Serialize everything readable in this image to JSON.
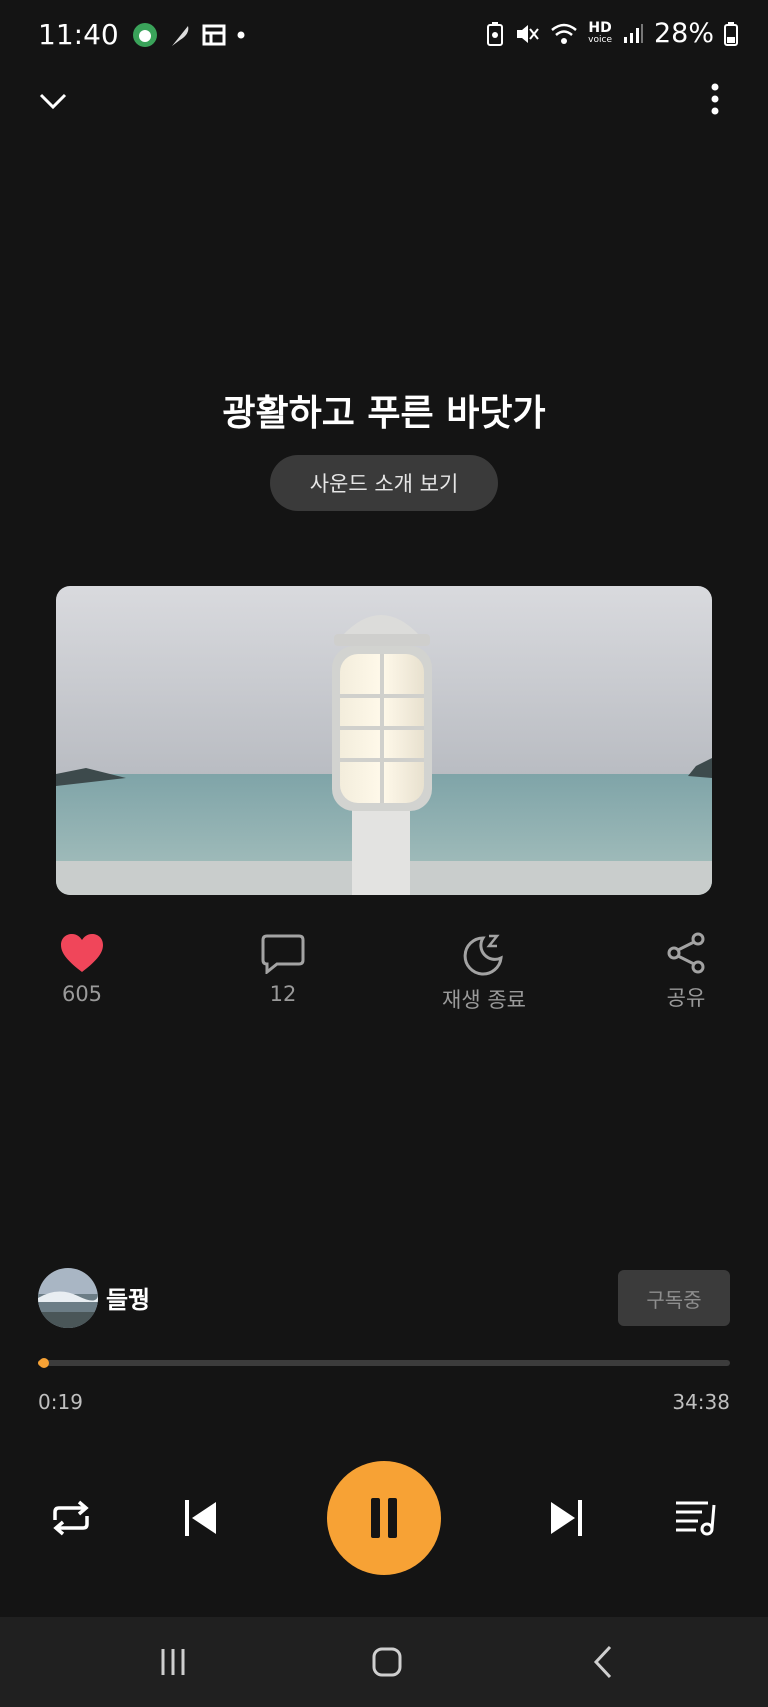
{
  "status_bar": {
    "time": "11:40",
    "network_label": "HD",
    "network_sub": "voice",
    "battery": "28%"
  },
  "header": {
    "collapse_icon": "chevron-down-icon",
    "more_icon": "more-vertical-icon"
  },
  "sound": {
    "title": "광활하고 푸른 바닷가",
    "intro_button": "사운드 소개 보기"
  },
  "actions": [
    {
      "icon": "heart-icon",
      "label": "605",
      "color": "#f0465a"
    },
    {
      "icon": "comment-icon",
      "label": "12"
    },
    {
      "icon": "sleep-timer-icon",
      "label": "재생 종료"
    },
    {
      "icon": "share-icon",
      "label": "공유"
    }
  ],
  "creator": {
    "name": "들꿩",
    "subscribe_label": "구독중"
  },
  "progress": {
    "current": "0:19",
    "duration": "34:38",
    "fraction": 0.009
  },
  "controls": {
    "repeat_icon": "repeat-icon",
    "prev_icon": "skip-previous-icon",
    "play_state": "playing",
    "next_icon": "skip-next-icon",
    "playlist_icon": "playlist-icon"
  },
  "colors": {
    "accent": "#f7a235",
    "background": "#141414",
    "like": "#f0465a"
  }
}
